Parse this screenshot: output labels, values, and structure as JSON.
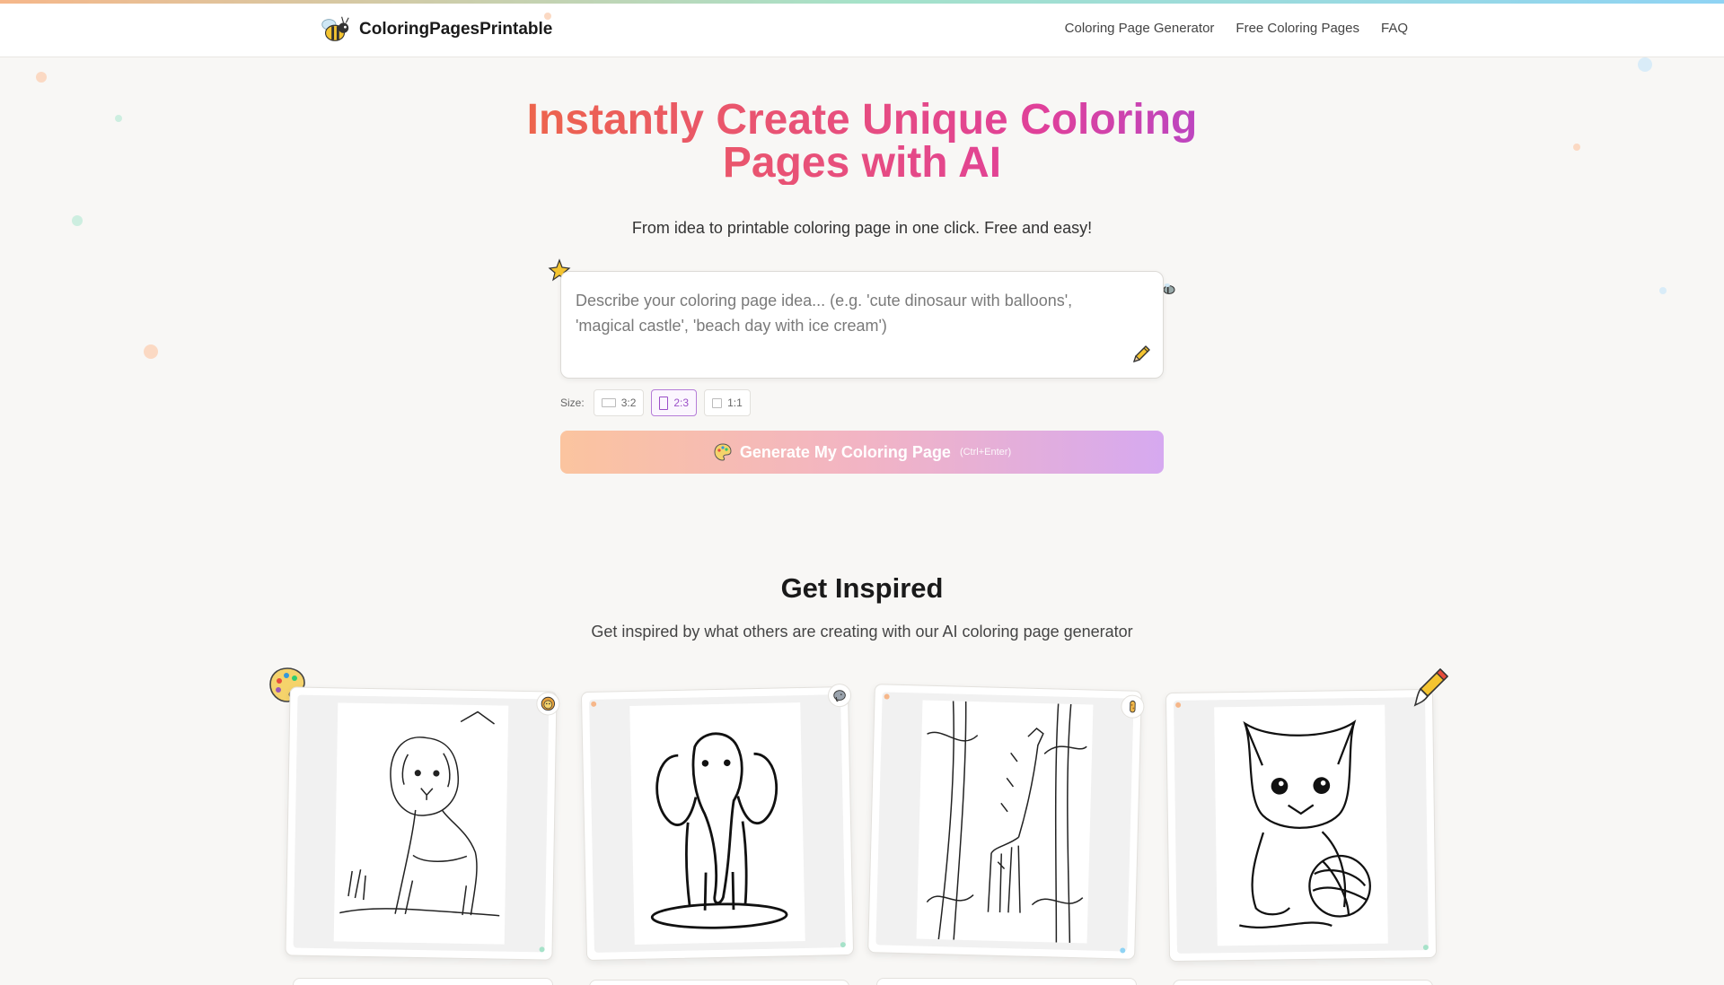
{
  "header": {
    "brand": "ColoringPagesPrintable",
    "nav": [
      "Coloring Page Generator",
      "Free Coloring Pages",
      "FAQ"
    ]
  },
  "hero": {
    "title_line1": "Instantly Create Unique Coloring",
    "title_line2": "Pages with AI",
    "subtitle": "From idea to printable coloring page in one click. Free and easy!"
  },
  "prompt": {
    "placeholder": "Describe your coloring page idea... (e.g. 'cute dinosaur with balloons', 'magical castle', 'beach day with ice cream')",
    "value": ""
  },
  "size": {
    "label": "Size:",
    "options": [
      "3:2",
      "2:3",
      "1:1"
    ],
    "selected": "2:3"
  },
  "generate": {
    "label": "Generate My Coloring Page",
    "shortcut": "(Ctrl+Enter)"
  },
  "inspired": {
    "title": "Get Inspired",
    "subtitle": "Get inspired by what others are creating with our AI coloring page generator"
  },
  "gallery": {
    "items": [
      {
        "subject": "lion",
        "badge_icon": "lion-icon"
      },
      {
        "subject": "elephant",
        "badge_icon": "elephant-icon"
      },
      {
        "subject": "giraffe",
        "badge_icon": "giraffe-icon"
      },
      {
        "subject": "kitten",
        "badge_icon": "brush-icon"
      }
    ]
  },
  "colors": {
    "title_gradient": [
      "#ef6c3a",
      "#e8507a",
      "#e0409a",
      "#a249dc"
    ],
    "button_gradient": [
      "#fbc49f",
      "#f2b4c4",
      "#d6a9f0"
    ],
    "active_size": "#9b4fc8"
  }
}
